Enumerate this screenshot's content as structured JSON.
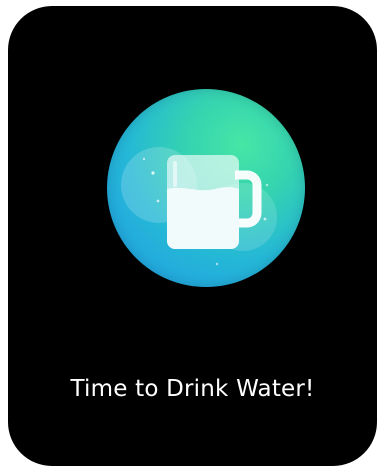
{
  "reminder": {
    "icon": "water-mug-icon",
    "message": "Time to Drink Water!"
  },
  "colors": {
    "background": "#000000",
    "badge_green": "#46e6a6",
    "badge_blue": "#1f98e6",
    "text": "#ffffff"
  }
}
